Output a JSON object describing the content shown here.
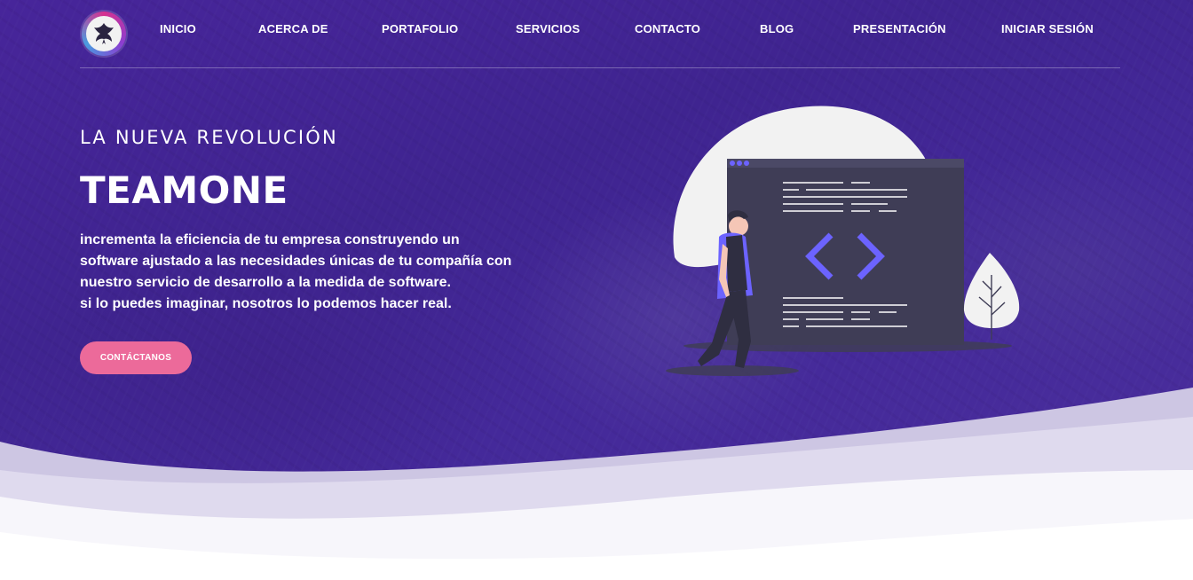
{
  "nav": {
    "logo_alt": "phoenix-logo-icon",
    "items": [
      {
        "label": "INICIO"
      },
      {
        "label": "ACERCA DE"
      },
      {
        "label": "PORTAFOLIO"
      },
      {
        "label": "SERVICIOS"
      },
      {
        "label": "CONTACTO"
      },
      {
        "label": "BLOG"
      },
      {
        "label": "PRESENTACIÓN"
      },
      {
        "label": "INICIAR SESIÓN"
      }
    ]
  },
  "hero": {
    "kicker": "LA NUEVA REVOLUCIÓN",
    "title": "TEAMONE",
    "description_lines": [
      "incrementa la eficiencia de tu empresa construyendo un",
      "software ajustado a las necesidades únicas de tu compañía con",
      "nuestro servicio de desarrollo a la medida de software.",
      "si lo puedes imaginar, nosotros lo podemos hacer real."
    ],
    "cta_label": "CONTÁCTANOS",
    "illustration": "developer-code-window-illustration"
  },
  "colors": {
    "hero_bg": "#43279a",
    "accent_pink": "#ec6a9a",
    "accent_purple": "#6c63ff",
    "window_dark": "#3f3d56"
  }
}
